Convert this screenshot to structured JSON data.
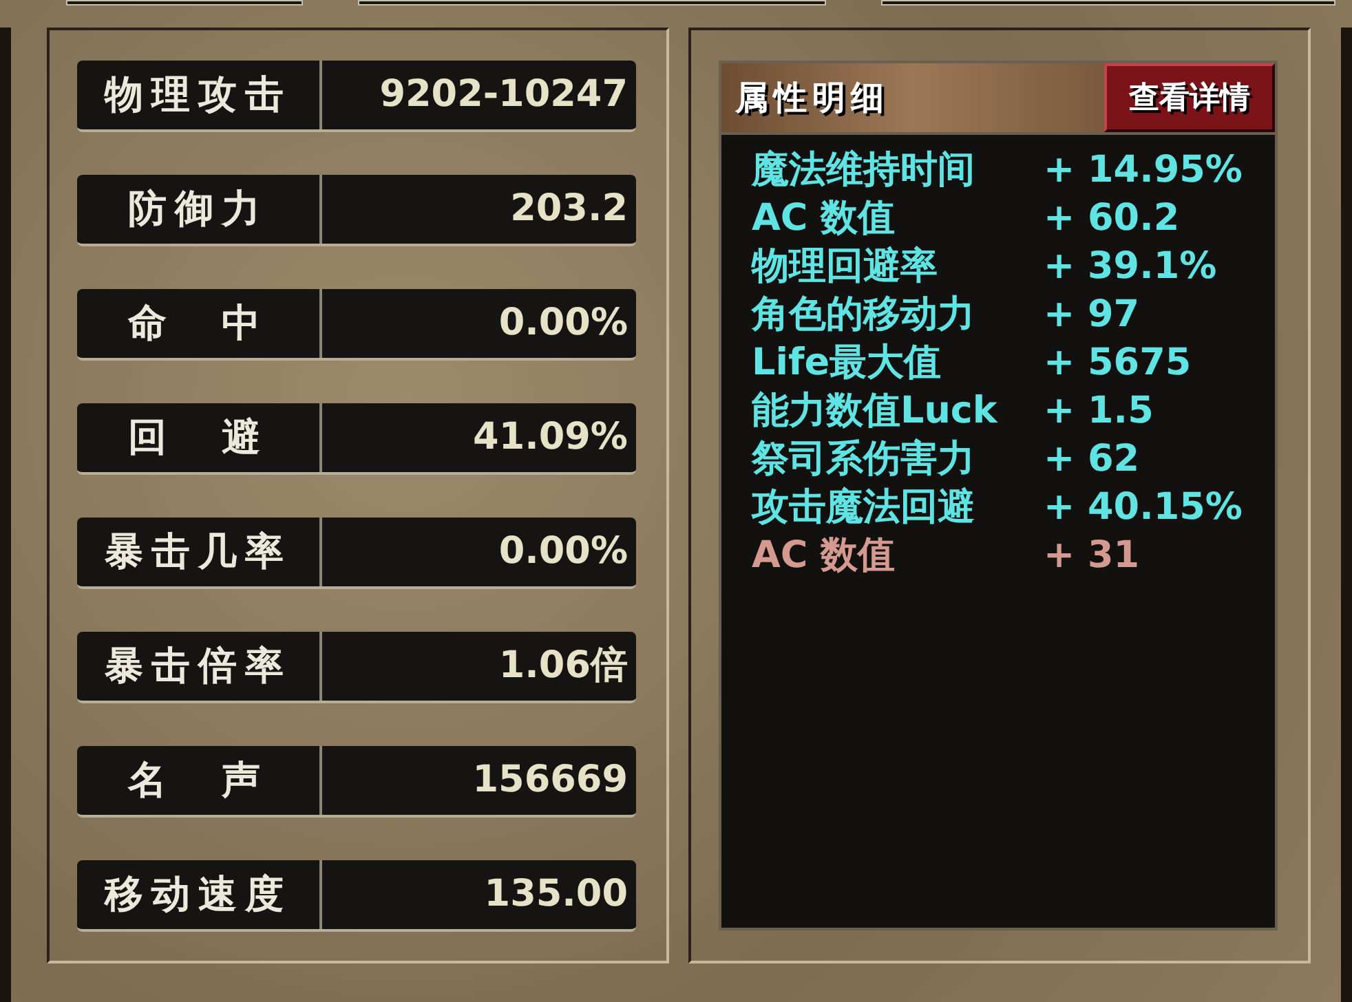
{
  "stats": [
    {
      "label": "物理攻击",
      "value": "9202-10247"
    },
    {
      "label": "防御力",
      "value": "203.2"
    },
    {
      "label": "命　中",
      "value": "0.00%"
    },
    {
      "label": "回　避",
      "value": "41.09%"
    },
    {
      "label": "暴击几率",
      "value": "0.00%"
    },
    {
      "label": "暴击倍率",
      "value": "1.06倍"
    },
    {
      "label": "名　声",
      "value": "156669"
    },
    {
      "label": "移动速度",
      "value": "135.00"
    }
  ],
  "details": {
    "title": "属性明细",
    "button": "查看详情",
    "attributes": [
      {
        "name": "魔法维持时间",
        "bonus": "+ 14.95%",
        "color": "#5fe3e3"
      },
      {
        "name": "AC 数值",
        "bonus": "+ 60.2",
        "color": "#5fe3e3"
      },
      {
        "name": "物理回避率",
        "bonus": "+ 39.1%",
        "color": "#5fe3e3"
      },
      {
        "name": "角色的移动力",
        "bonus": "+ 97",
        "color": "#5fe3e3"
      },
      {
        "name": "Life最大值",
        "bonus": "+ 5675",
        "color": "#5fe3e3"
      },
      {
        "name": "能力数值Luck",
        "bonus": "+ 1.5",
        "color": "#5fe3e3"
      },
      {
        "name": "祭司系伤害力",
        "bonus": "+ 62",
        "color": "#5fe3e3"
      },
      {
        "name": "攻击魔法回避",
        "bonus": "+ 40.15%",
        "color": "#5fe3e3"
      },
      {
        "name": "AC 数值",
        "bonus": "+ 31",
        "color": "#d49a8f"
      }
    ]
  }
}
